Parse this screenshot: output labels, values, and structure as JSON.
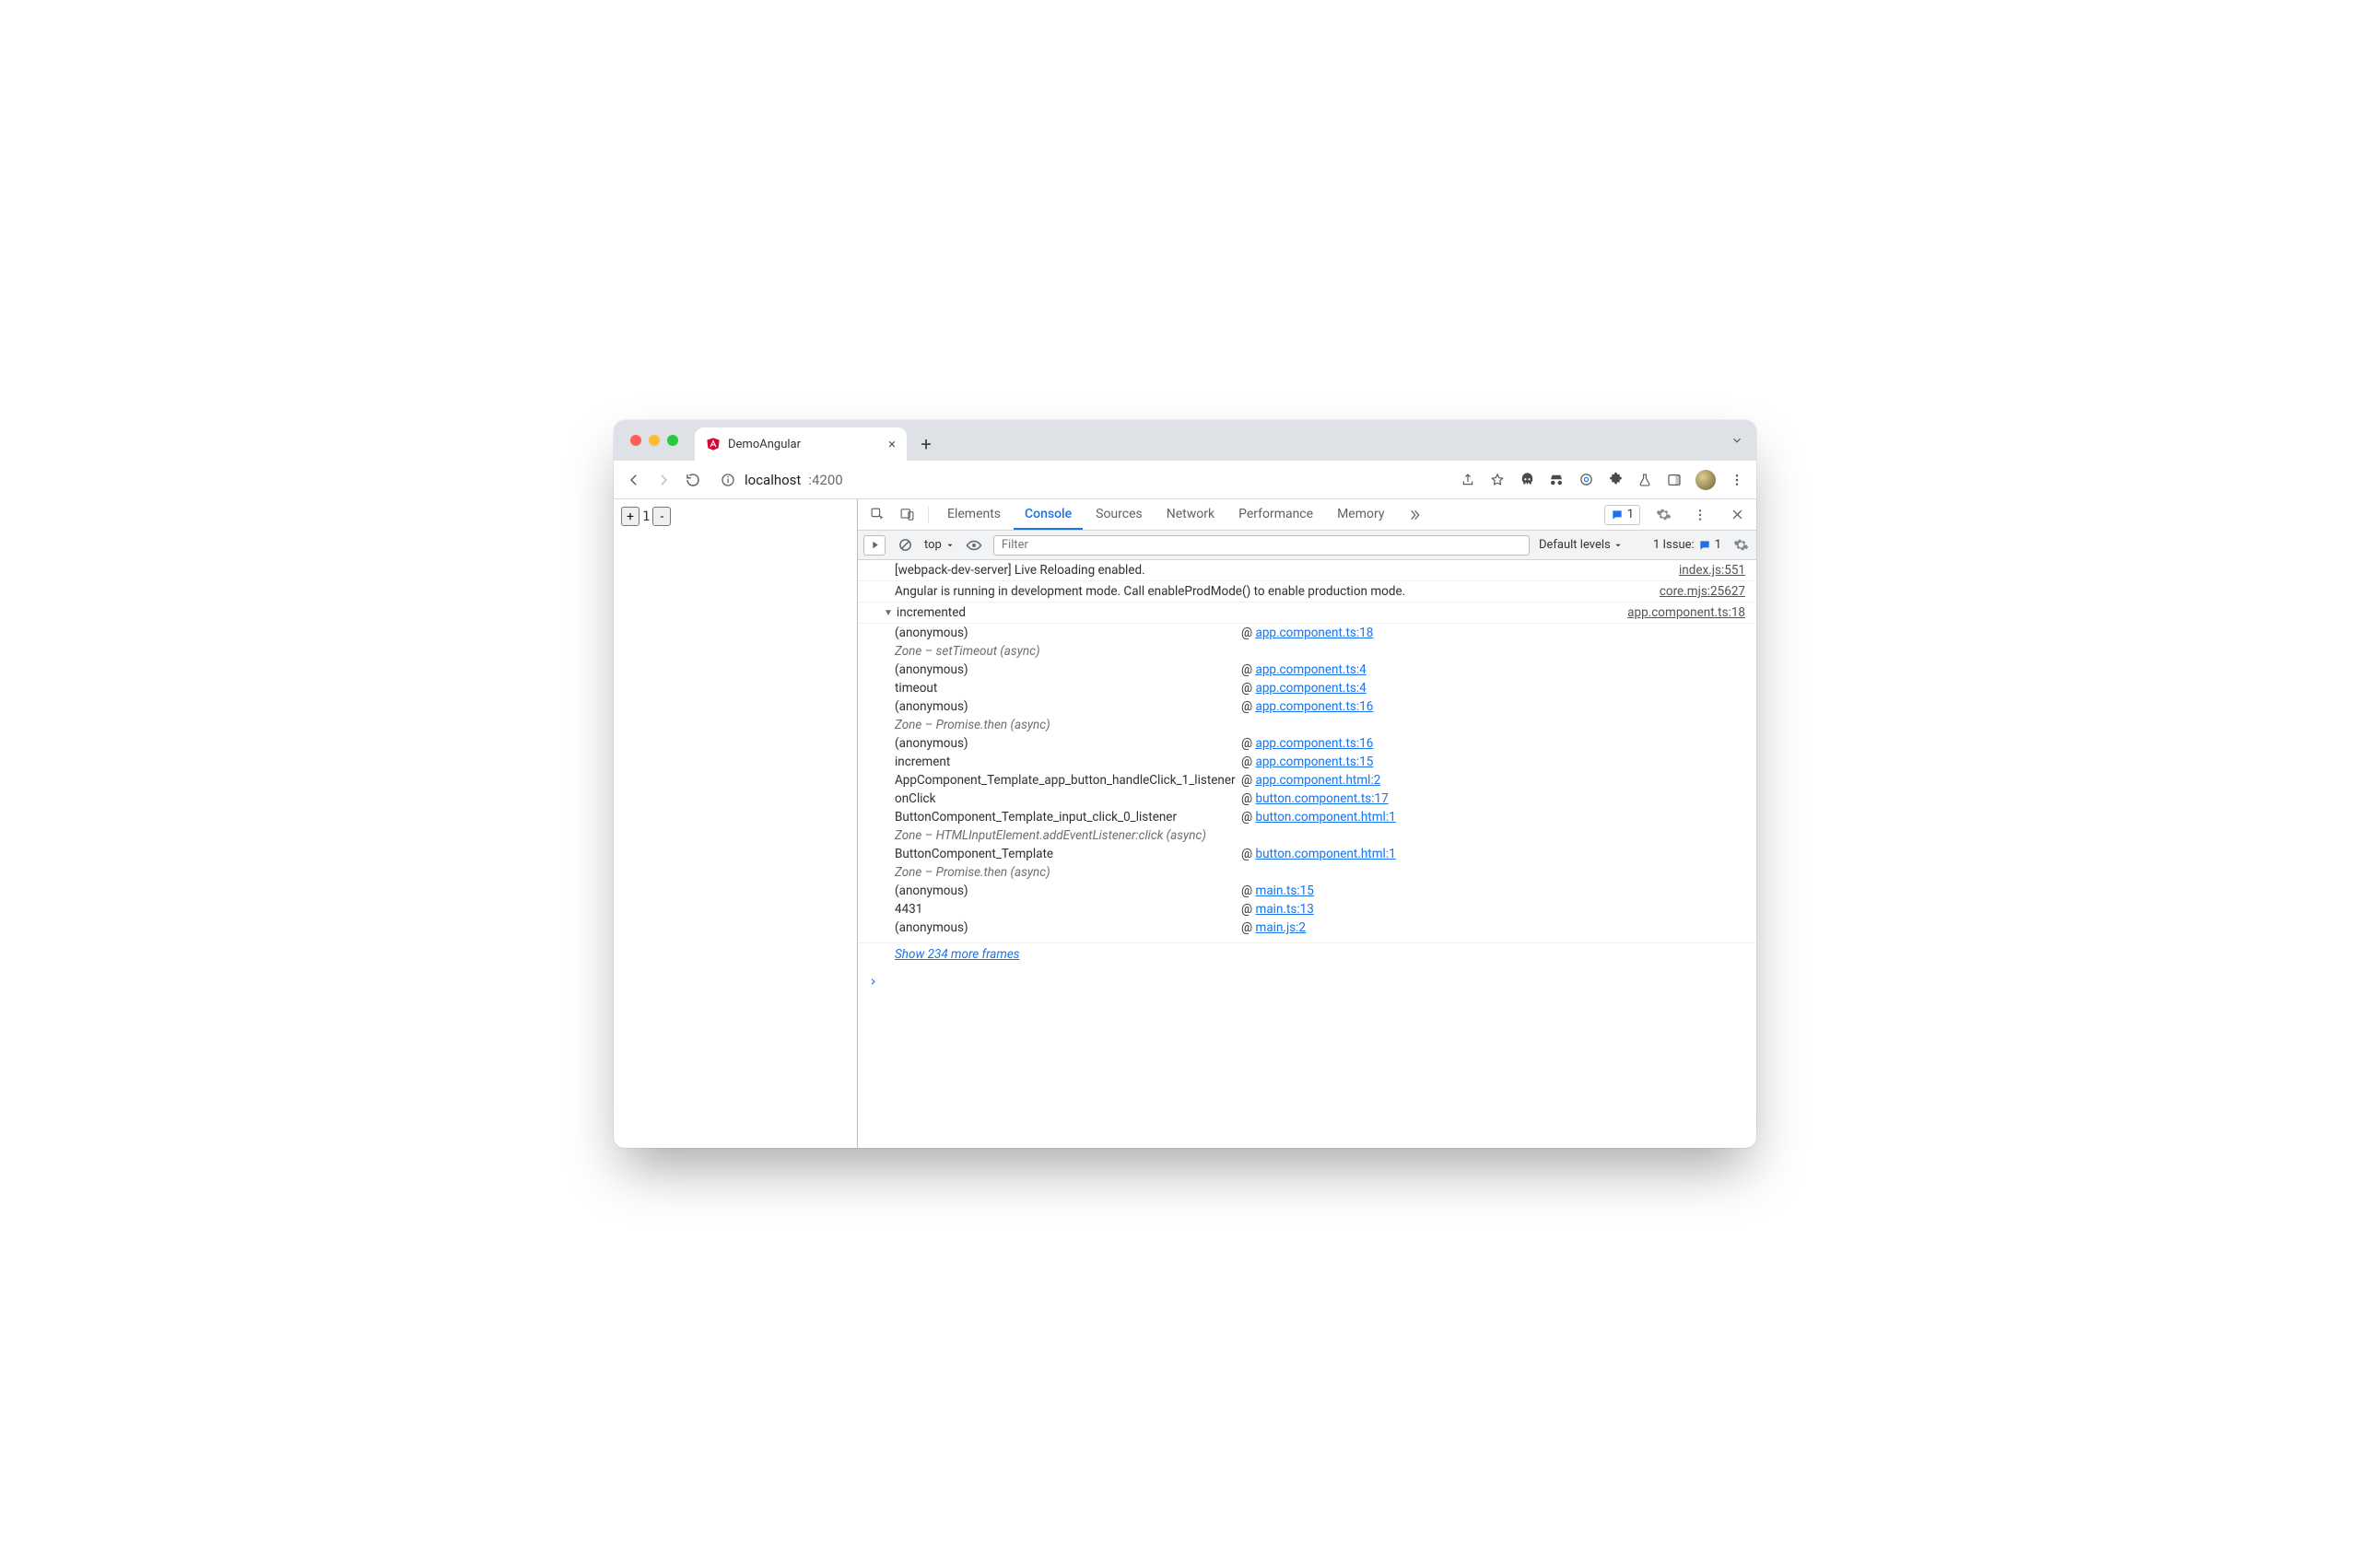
{
  "browser": {
    "tab_title": "DemoAngular",
    "url_host": "localhost",
    "url_port": ":4200"
  },
  "page": {
    "counter_value": "1",
    "plus_label": "+",
    "minus_label": "-"
  },
  "devtools": {
    "tabs": {
      "elements": "Elements",
      "console": "Console",
      "sources": "Sources",
      "network": "Network",
      "performance": "Performance",
      "memory": "Memory"
    },
    "issue_chip_count": "1",
    "toolbar": {
      "context": "top",
      "filter_placeholder": "Filter",
      "levels": "Default levels",
      "issues_label": "1 Issue:",
      "issues_count": "1"
    }
  },
  "console": {
    "log1": {
      "msg": "[webpack-dev-server] Live Reloading enabled.",
      "src": "index.js:551"
    },
    "log2": {
      "msg": "Angular is running in development mode. Call enableProdMode() to enable production mode.",
      "src": "core.mjs:25627"
    },
    "trace": {
      "label": "incremented",
      "src": "app.component.ts:18",
      "frames": [
        {
          "fn": "(anonymous)",
          "at": "app.component.ts:18",
          "t": "n"
        },
        {
          "fn": "Zone – setTimeout (async)",
          "at": "",
          "t": "z"
        },
        {
          "fn": "(anonymous)",
          "at": "app.component.ts:4",
          "t": "n"
        },
        {
          "fn": "timeout",
          "at": "app.component.ts:4",
          "t": "n"
        },
        {
          "fn": "(anonymous)",
          "at": "app.component.ts:16",
          "t": "n"
        },
        {
          "fn": "Zone – Promise.then (async)",
          "at": "",
          "t": "z"
        },
        {
          "fn": "(anonymous)",
          "at": "app.component.ts:16",
          "t": "n"
        },
        {
          "fn": "increment",
          "at": "app.component.ts:15",
          "t": "n"
        },
        {
          "fn": "AppComponent_Template_app_button_handleClick_1_listener",
          "at": "app.component.html:2",
          "t": "n"
        },
        {
          "fn": "onClick",
          "at": "button.component.ts:17",
          "t": "n"
        },
        {
          "fn": "ButtonComponent_Template_input_click_0_listener",
          "at": "button.component.html:1",
          "t": "n"
        },
        {
          "fn": "Zone – HTMLInputElement.addEventListener:click (async)",
          "at": "",
          "t": "z"
        },
        {
          "fn": "ButtonComponent_Template",
          "at": "button.component.html:1",
          "t": "n"
        },
        {
          "fn": "Zone – Promise.then (async)",
          "at": "",
          "t": "z"
        },
        {
          "fn": "(anonymous)",
          "at": "main.ts:15",
          "t": "n"
        },
        {
          "fn": "4431",
          "at": "main.ts:13",
          "t": "n"
        },
        {
          "fn": "(anonymous)",
          "at": "main.js:2",
          "t": "n"
        }
      ],
      "show_more": "Show 234 more frames"
    },
    "prompt": "›"
  }
}
